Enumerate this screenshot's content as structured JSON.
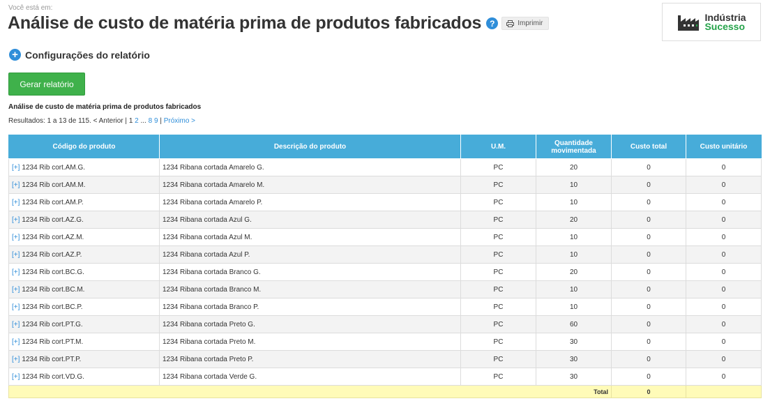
{
  "breadcrumb": "Você está em:",
  "page": {
    "title": "Análise de custo de matéria prima de produtos fabricados",
    "help_icon": "?",
    "print_label": "Imprimir"
  },
  "logo": {
    "line1": "Indústria",
    "line2": "Sucesso"
  },
  "config": {
    "icon": "+",
    "label": "Configurações do relatório"
  },
  "generate_button": "Gerar relatório",
  "report_title": "Análise de custo de matéria prima de produtos fabricados",
  "pagination": {
    "prefix": "Resultados: 1 a 13 de 115. < Anterior |",
    "current": "1",
    "page2": "2",
    "ellipsis": "...",
    "page8": "8",
    "page9": "9",
    "separator": "|",
    "next": "Próximo >"
  },
  "table": {
    "headers": [
      "Código do produto",
      "Descrição do produto",
      "U.M.",
      "Quantidade movimentada",
      "Custo total",
      "Custo unitário"
    ],
    "expand_label": "[+]",
    "rows": [
      {
        "code": "1234 Rib cort.AM.G.",
        "desc": "1234 Ribana cortada Amarelo G.",
        "um": "PC",
        "qty": "20",
        "total": "0",
        "unit": "0"
      },
      {
        "code": "1234 Rib cort.AM.M.",
        "desc": "1234 Ribana cortada Amarelo M.",
        "um": "PC",
        "qty": "10",
        "total": "0",
        "unit": "0"
      },
      {
        "code": "1234 Rib cort.AM.P.",
        "desc": "1234 Ribana cortada Amarelo P.",
        "um": "PC",
        "qty": "10",
        "total": "0",
        "unit": "0"
      },
      {
        "code": "1234 Rib cort.AZ.G.",
        "desc": "1234 Ribana cortada Azul G.",
        "um": "PC",
        "qty": "20",
        "total": "0",
        "unit": "0"
      },
      {
        "code": "1234 Rib cort.AZ.M.",
        "desc": "1234 Ribana cortada Azul M.",
        "um": "PC",
        "qty": "10",
        "total": "0",
        "unit": "0"
      },
      {
        "code": "1234 Rib cort.AZ.P.",
        "desc": "1234 Ribana cortada Azul P.",
        "um": "PC",
        "qty": "10",
        "total": "0",
        "unit": "0"
      },
      {
        "code": "1234 Rib cort.BC.G.",
        "desc": "1234 Ribana cortada Branco G.",
        "um": "PC",
        "qty": "20",
        "total": "0",
        "unit": "0"
      },
      {
        "code": "1234 Rib cort.BC.M.",
        "desc": "1234 Ribana cortada Branco M.",
        "um": "PC",
        "qty": "10",
        "total": "0",
        "unit": "0"
      },
      {
        "code": "1234 Rib cort.BC.P.",
        "desc": "1234 Ribana cortada Branco P.",
        "um": "PC",
        "qty": "10",
        "total": "0",
        "unit": "0"
      },
      {
        "code": "1234 Rib cort.PT.G.",
        "desc": "1234 Ribana cortada Preto G.",
        "um": "PC",
        "qty": "60",
        "total": "0",
        "unit": "0"
      },
      {
        "code": "1234 Rib cort.PT.M.",
        "desc": "1234 Ribana cortada Preto M.",
        "um": "PC",
        "qty": "30",
        "total": "0",
        "unit": "0"
      },
      {
        "code": "1234 Rib cort.PT.P.",
        "desc": "1234 Ribana cortada Preto P.",
        "um": "PC",
        "qty": "30",
        "total": "0",
        "unit": "0"
      },
      {
        "code": "1234 Rib cort.VD.G.",
        "desc": "1234 Ribana cortada Verde G.",
        "um": "PC",
        "qty": "30",
        "total": "0",
        "unit": "0"
      }
    ],
    "total_label": "Total",
    "total_value": "0"
  },
  "colors": {
    "header_blue": "#47acd9",
    "accent_blue": "#2f8ed9",
    "button_green": "#3fb14b",
    "total_yellow": "#fffbb8"
  },
  "icons": [
    "help-icon",
    "printer-icon",
    "factory-icon",
    "plus-circle-icon"
  ]
}
